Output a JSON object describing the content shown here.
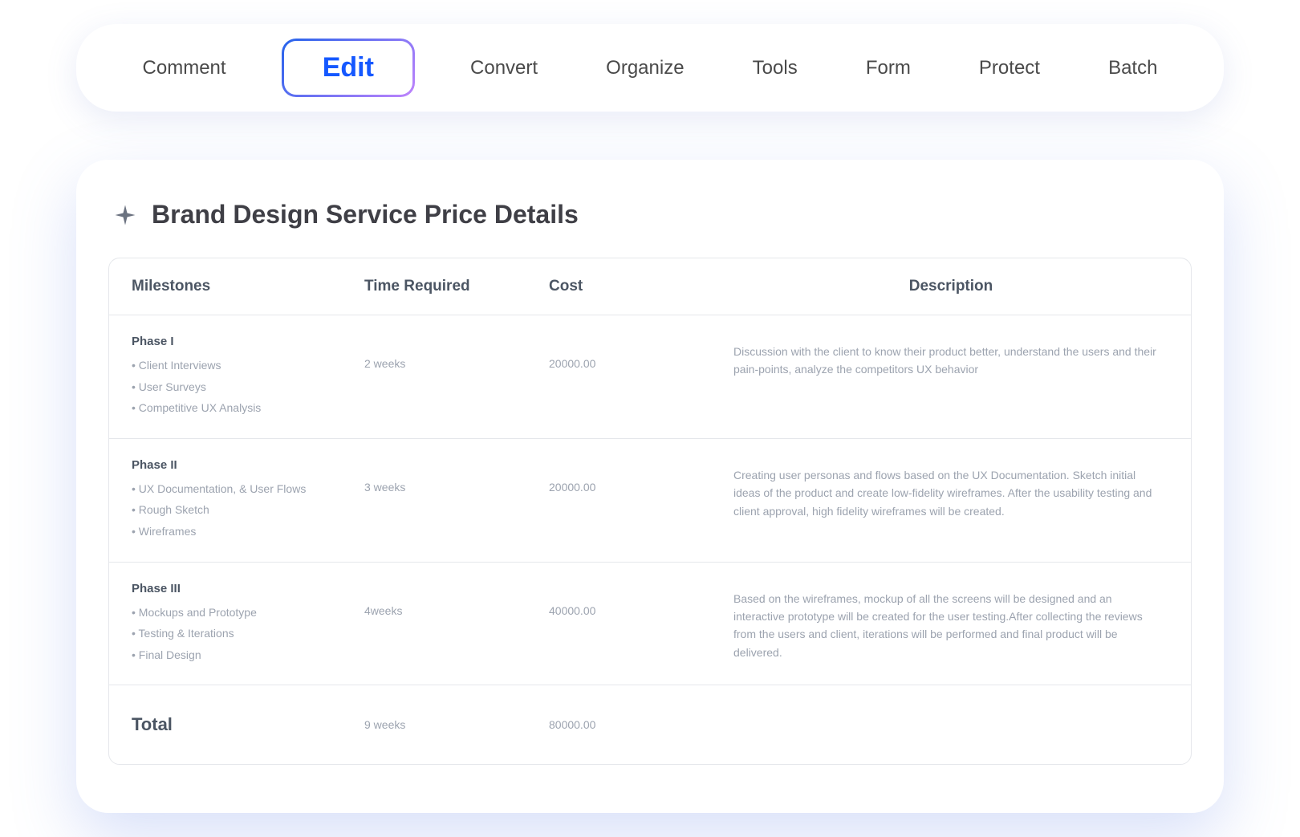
{
  "tabs": {
    "items": [
      "Comment",
      "Edit",
      "Convert",
      "Organize",
      "Tools",
      "Form",
      "Protect",
      "Batch"
    ],
    "active_index": 1
  },
  "document": {
    "title": "Brand Design Service Price Details",
    "table": {
      "headers": [
        "Milestones",
        "Time Required",
        "Cost",
        "Description"
      ],
      "rows": [
        {
          "phase": "Phase I",
          "items": [
            "Client Interviews",
            "User Surveys",
            "Competitive UX Analysis"
          ],
          "time": "2 weeks",
          "cost": "20000.00",
          "description": "Discussion with the client to know their product better, understand the users and their pain-points, analyze the competitors UX behavior"
        },
        {
          "phase": "Phase II",
          "items": [
            "UX Documentation, & User Flows",
            "Rough Sketch",
            "Wireframes"
          ],
          "time": "3 weeks",
          "cost": "20000.00",
          "description": "Creating user personas and flows based on the UX Documentation. Sketch initial ideas of the product and create low-fidelity wireframes. After the usability testing and client approval, high fidelity wireframes will be created."
        },
        {
          "phase": "Phase III",
          "items": [
            "Mockups and Prototype",
            "Testing & Iterations",
            "Final Design"
          ],
          "time": "4weeks",
          "cost": "40000.00",
          "description": "Based on the wireframes, mockup of all the screens will be designed and an interactive prototype will be created for the user testing.After collecting the reviews from the users and client, iterations will be performed and final product will be delivered."
        }
      ],
      "total": {
        "label": "Total",
        "time": "9 weeks",
        "cost": "80000.00"
      }
    }
  }
}
